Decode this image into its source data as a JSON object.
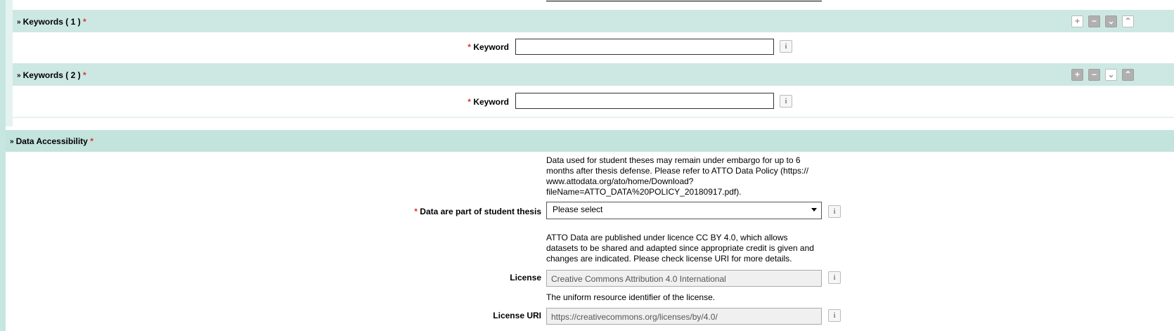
{
  "keywords_group": {
    "sections": [
      {
        "title": "Keywords ( 1 )",
        "required_mark": "*",
        "field_label": "Keyword",
        "field_value": "",
        "header_button_style": "outline-collapse"
      },
      {
        "title": "Keywords ( 2 )",
        "required_mark": "*",
        "field_label": "Keyword",
        "field_value": "",
        "header_button_style": "outline-expand"
      }
    ],
    "header_buttons": {
      "add": "+",
      "remove": "−",
      "down": "⌄",
      "up": "⌃"
    }
  },
  "data_accessibility": {
    "title": "Data Accessibility",
    "required_mark": "*",
    "student_thesis_help": "Data used for student theses may remain under embargo for up to 6 months after thesis defense. Please refer to ATTO Data Policy (https:// www.attodata.org/ato/home/Download? fileName=ATTO_DATA%20POLICY_20180917.pdf).",
    "student_thesis_label": "Data are part of student thesis",
    "student_thesis_value": "Please select",
    "license_help": "ATTO Data are published under licence CC BY 4.0, which allows datasets to be shared and adapted since appropriate credit is given and changes are indicated. Please check license URI for more details.",
    "license_label": "License",
    "license_value": "Creative Commons Attribution 4.0 International",
    "license_uri_help": "The uniform resource identifier of the license.",
    "license_uri_label": "License URI",
    "license_uri_value": "https://creativecommons.org/licenses/by/4.0/"
  },
  "icons": {
    "info": "i",
    "chevron": "»"
  },
  "colors": {
    "header_bg": "#cde8e2",
    "main_header_bg": "#c3e4dd",
    "required": "#e03030"
  }
}
